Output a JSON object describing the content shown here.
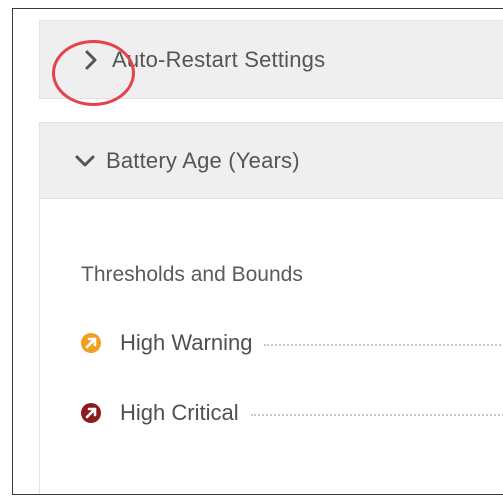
{
  "panels": {
    "auto_restart": {
      "title": "Auto-Restart Settings",
      "state": "collapsed"
    },
    "battery_age": {
      "title": "Battery Age (Years)",
      "state": "expanded",
      "section_title": "Thresholds and Bounds",
      "thresholds": [
        {
          "label": "High Warning",
          "icon": "high-warning-icon",
          "color": "#f0a01e"
        },
        {
          "label": "High Critical",
          "icon": "high-critical-icon",
          "color": "#8e1b1b"
        }
      ]
    }
  },
  "annotation": {
    "type": "highlight-circle",
    "color": "#e5434a",
    "target": "auto-restart-expand-chevron"
  }
}
